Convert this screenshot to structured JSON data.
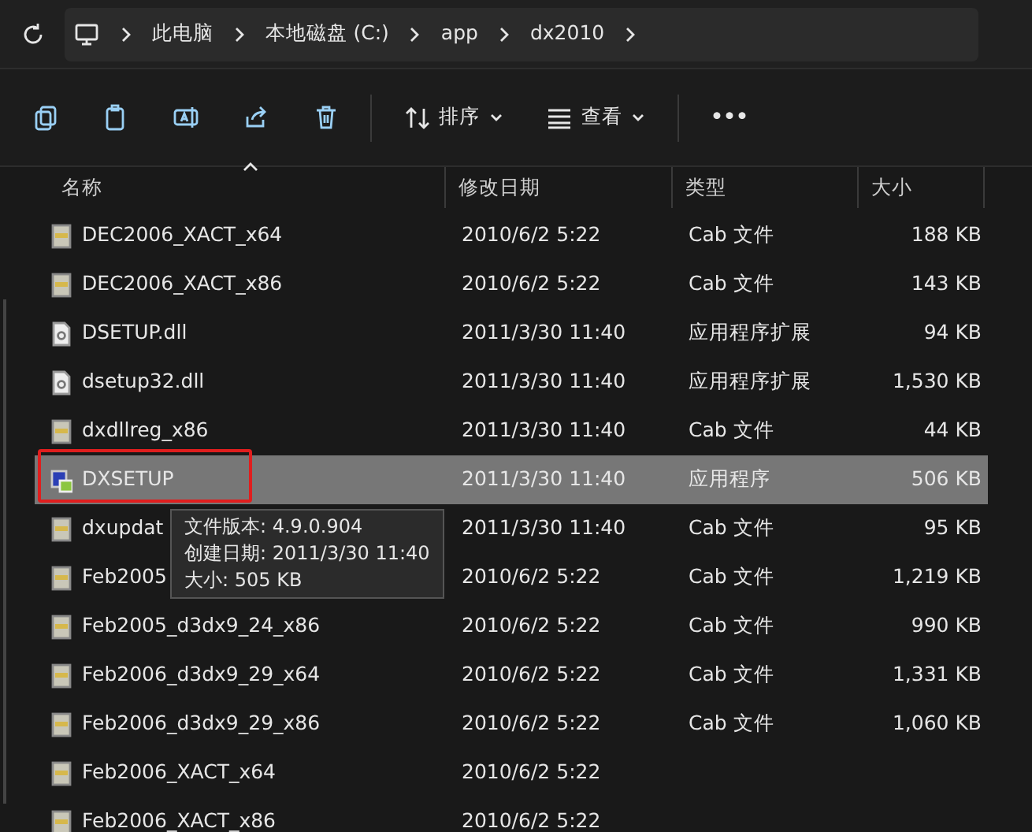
{
  "breadcrumb": [
    "此电脑",
    "本地磁盘 (C:)",
    "app",
    "dx2010"
  ],
  "toolbar": {
    "sort": "排序",
    "view": "查看",
    "more": "•••"
  },
  "columns": [
    "名称",
    "修改日期",
    "类型",
    "大小"
  ],
  "rows": [
    {
      "name": "DEC2006_XACT_x64",
      "date": "2010/6/2 5:22",
      "type": "Cab 文件",
      "size": "188 KB",
      "kind": "cab",
      "selected": false,
      "highlighted": false
    },
    {
      "name": "DEC2006_XACT_x86",
      "date": "2010/6/2 5:22",
      "type": "Cab 文件",
      "size": "143 KB",
      "kind": "cab",
      "selected": false,
      "highlighted": false
    },
    {
      "name": "DSETUP.dll",
      "date": "2011/3/30 11:40",
      "type": "应用程序扩展",
      "size": "94 KB",
      "kind": "dll",
      "selected": false,
      "highlighted": false
    },
    {
      "name": "dsetup32.dll",
      "date": "2011/3/30 11:40",
      "type": "应用程序扩展",
      "size": "1,530 KB",
      "kind": "dll",
      "selected": false,
      "highlighted": false
    },
    {
      "name": "dxdllreg_x86",
      "date": "2011/3/30 11:40",
      "type": "Cab 文件",
      "size": "44 KB",
      "kind": "cab",
      "selected": false,
      "highlighted": false
    },
    {
      "name": "DXSETUP",
      "date": "2011/3/30 11:40",
      "type": "应用程序",
      "size": "506 KB",
      "kind": "exe",
      "selected": true,
      "highlighted": true
    },
    {
      "name": "dxupdat",
      "date": "2011/3/30 11:40",
      "type": "Cab 文件",
      "size": "95 KB",
      "kind": "cab",
      "selected": false,
      "highlighted": false
    },
    {
      "name": "Feb2005",
      "date": "2010/6/2 5:22",
      "type": "Cab 文件",
      "size": "1,219 KB",
      "kind": "cab",
      "selected": false,
      "highlighted": false
    },
    {
      "name": "Feb2005_d3dx9_24_x86",
      "date": "2010/6/2 5:22",
      "type": "Cab 文件",
      "size": "990 KB",
      "kind": "cab",
      "selected": false,
      "highlighted": false
    },
    {
      "name": "Feb2006_d3dx9_29_x64",
      "date": "2010/6/2 5:22",
      "type": "Cab 文件",
      "size": "1,331 KB",
      "kind": "cab",
      "selected": false,
      "highlighted": false
    },
    {
      "name": "Feb2006_d3dx9_29_x86",
      "date": "2010/6/2 5:22",
      "type": "Cab 文件",
      "size": "1,060 KB",
      "kind": "cab",
      "selected": false,
      "highlighted": false
    },
    {
      "name": "Feb2006_XACT_x64",
      "date": "2010/6/2 5:22",
      "kind": "cab",
      "selected": false,
      "highlighted": false
    },
    {
      "name": "Feb2006_XACT_x86",
      "date": "2010/6/2 5:22",
      "kind": "cab",
      "selected": false,
      "highlighted": false
    }
  ],
  "tooltip": [
    "文件版本: 4.9.0.904",
    "创建日期: 2011/3/30 11:40",
    "大小: 505 KB"
  ]
}
